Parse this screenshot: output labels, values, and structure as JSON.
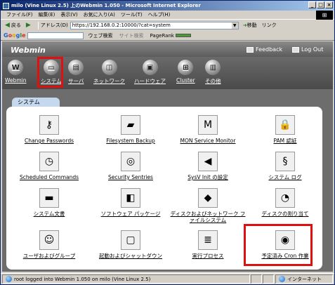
{
  "window": {
    "title": "milo (Vine Linux 2.5) 上のWebmin 1.050 - Microsoft Internet Explorer"
  },
  "menubar": [
    "ファイル(F)",
    "編集(E)",
    "表示(V)",
    "お気に入り(A)",
    "ツール(T)",
    "ヘルプ(H)"
  ],
  "toolbar": {
    "back": "戻る",
    "address_label": "アドレス(D)",
    "address_value": "https://192.168.0.2:10000/?cat=system",
    "go_label": "移動",
    "links_label": "リンク"
  },
  "googlebar": {
    "logo": "Google",
    "web_search": "ウェブ検索",
    "site_search": "サイト検索",
    "pagerank": "PageRank"
  },
  "webmin": {
    "logo": "Webmin",
    "feedback": "Feedback",
    "logout": "Log Out",
    "categories": [
      {
        "label": "Webmin",
        "icon": "W"
      },
      {
        "label": "システム",
        "icon": "▭"
      },
      {
        "label": "サーバ",
        "icon": "▤"
      },
      {
        "label": "ネットワーク",
        "icon": "◫"
      },
      {
        "label": "ハードウェア",
        "icon": "▣"
      },
      {
        "label": "Cluster",
        "icon": "⊞"
      },
      {
        "label": "その他",
        "icon": "▥"
      }
    ],
    "section_tab": "システム",
    "modules": [
      {
        "label": "Change Passwords",
        "icon": "⚷"
      },
      {
        "label": "Filesystem Backup",
        "icon": "▰"
      },
      {
        "label": "MON Service Monitor",
        "icon": "M"
      },
      {
        "label": "PAM 認証",
        "icon": "🔒"
      },
      {
        "label": "Scheduled Commands",
        "icon": "◷"
      },
      {
        "label": "Security Sentries",
        "icon": "◎"
      },
      {
        "label": "SysV Init の設定",
        "icon": "◀"
      },
      {
        "label": "システム ログ",
        "icon": "§"
      },
      {
        "label": "システム文書",
        "icon": "▬"
      },
      {
        "label": "ソフトウェア パッケージ",
        "icon": "◧"
      },
      {
        "label": "ディスクおよびネットワーク ファイルシステム",
        "icon": "◆"
      },
      {
        "label": "ディスクの割り当て",
        "icon": "◔"
      },
      {
        "label": "ユーザおよびグループ",
        "icon": "☺"
      },
      {
        "label": "起動およびシャットダウン",
        "icon": "▢"
      },
      {
        "label": "実行プロセス",
        "icon": "≣"
      },
      {
        "label": "予定済み Cron 作業",
        "icon": "◉"
      }
    ]
  },
  "status": {
    "text": "root logged into Webmin 1.050 on milo (Vine Linux 2.5)",
    "zone": "インターネット"
  },
  "colors": {
    "highlight": "#e01010",
    "titlebar": "#0a246a",
    "panel_tab": "#c6d8ee"
  }
}
